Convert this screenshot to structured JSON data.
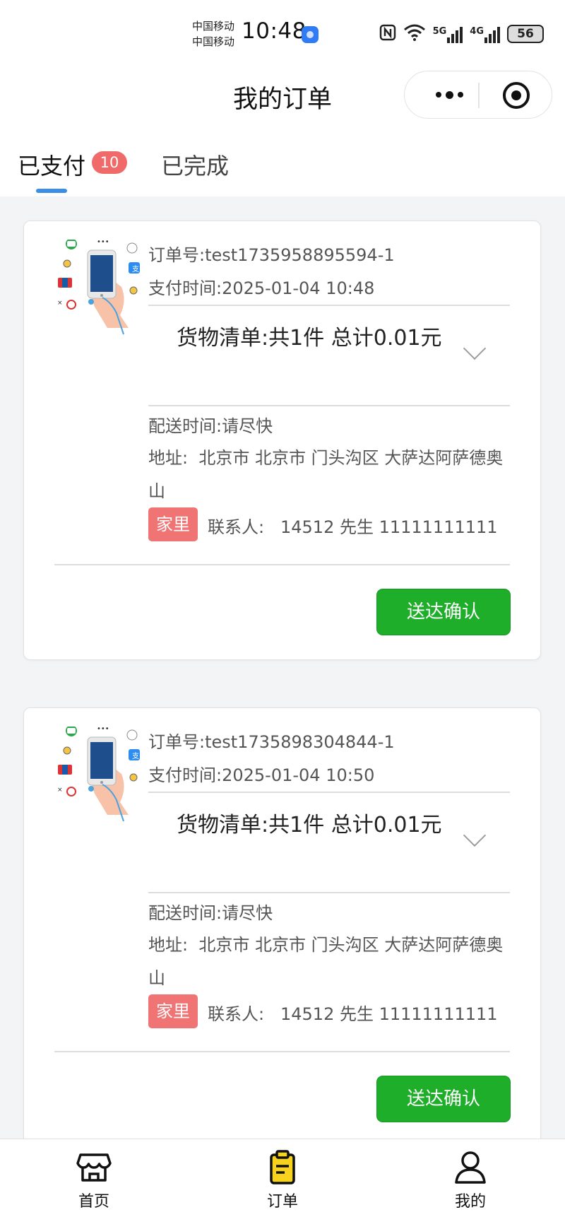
{
  "status_bar": {
    "carrier_1": "中国移动",
    "carrier_2": "中国移动",
    "time": "10:48",
    "battery": "56",
    "net_5g": "5G",
    "net_4g": "4G"
  },
  "nav": {
    "title": "我的订单"
  },
  "tabs": [
    {
      "label": "已支付",
      "badge": "10",
      "active": true
    },
    {
      "label": "已完成",
      "active": false
    }
  ],
  "orders": [
    {
      "order_no_label": "订单号:",
      "order_no": "test1735958895594-1",
      "pay_time_label": "支付时间:",
      "pay_time": "2025-01-04 10:48",
      "goods_summary": "货物清单:共1件 总计0.01元",
      "delivery_label": "配送时间:",
      "delivery_time": "请尽快",
      "address_label": "地址:",
      "address": "北京市 北京市 门头沟区 大萨达阿萨德奥山",
      "tag": "家里",
      "contact_label": "联系人:",
      "contact": "14512 先生 11111111111",
      "confirm_label": "送达确认"
    },
    {
      "order_no_label": "订单号:",
      "order_no": "test1735898304844-1",
      "pay_time_label": "支付时间:",
      "pay_time": "2025-01-04 10:50",
      "goods_summary": "货物清单:共1件 总计0.01元",
      "delivery_label": "配送时间:",
      "delivery_time": "请尽快",
      "address_label": "地址:",
      "address": "北京市 北京市 门头沟区 大萨达阿萨德奥山",
      "tag": "家里",
      "contact_label": "联系人:",
      "contact": "14512 先生 11111111111",
      "confirm_label": "送达确认"
    }
  ],
  "bottom_nav": [
    {
      "label": "首页",
      "icon": "store-icon"
    },
    {
      "label": "订单",
      "icon": "order-clipboard-icon",
      "active": true
    },
    {
      "label": "我的",
      "icon": "user-icon"
    }
  ],
  "colors": {
    "accent_blue": "#3a8ee6",
    "badge_red": "#f06a6a",
    "confirm_green": "#1fae2a",
    "tag_red": "#f07474",
    "order_icon_yellow": "#f7d21e"
  }
}
